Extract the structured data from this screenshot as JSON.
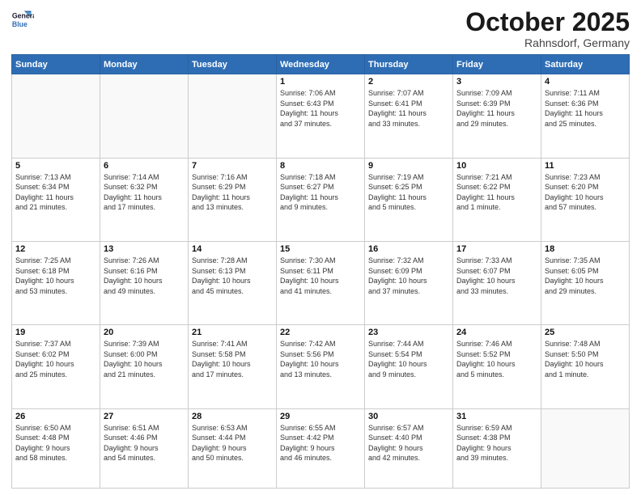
{
  "logo": {
    "line1": "General",
    "line2": "Blue"
  },
  "title": "October 2025",
  "location": "Rahnsdorf, Germany",
  "weekdays": [
    "Sunday",
    "Monday",
    "Tuesday",
    "Wednesday",
    "Thursday",
    "Friday",
    "Saturday"
  ],
  "weeks": [
    [
      {
        "day": "",
        "info": ""
      },
      {
        "day": "",
        "info": ""
      },
      {
        "day": "",
        "info": ""
      },
      {
        "day": "1",
        "info": "Sunrise: 7:06 AM\nSunset: 6:43 PM\nDaylight: 11 hours\nand 37 minutes."
      },
      {
        "day": "2",
        "info": "Sunrise: 7:07 AM\nSunset: 6:41 PM\nDaylight: 11 hours\nand 33 minutes."
      },
      {
        "day": "3",
        "info": "Sunrise: 7:09 AM\nSunset: 6:39 PM\nDaylight: 11 hours\nand 29 minutes."
      },
      {
        "day": "4",
        "info": "Sunrise: 7:11 AM\nSunset: 6:36 PM\nDaylight: 11 hours\nand 25 minutes."
      }
    ],
    [
      {
        "day": "5",
        "info": "Sunrise: 7:13 AM\nSunset: 6:34 PM\nDaylight: 11 hours\nand 21 minutes."
      },
      {
        "day": "6",
        "info": "Sunrise: 7:14 AM\nSunset: 6:32 PM\nDaylight: 11 hours\nand 17 minutes."
      },
      {
        "day": "7",
        "info": "Sunrise: 7:16 AM\nSunset: 6:29 PM\nDaylight: 11 hours\nand 13 minutes."
      },
      {
        "day": "8",
        "info": "Sunrise: 7:18 AM\nSunset: 6:27 PM\nDaylight: 11 hours\nand 9 minutes."
      },
      {
        "day": "9",
        "info": "Sunrise: 7:19 AM\nSunset: 6:25 PM\nDaylight: 11 hours\nand 5 minutes."
      },
      {
        "day": "10",
        "info": "Sunrise: 7:21 AM\nSunset: 6:22 PM\nDaylight: 11 hours\nand 1 minute."
      },
      {
        "day": "11",
        "info": "Sunrise: 7:23 AM\nSunset: 6:20 PM\nDaylight: 10 hours\nand 57 minutes."
      }
    ],
    [
      {
        "day": "12",
        "info": "Sunrise: 7:25 AM\nSunset: 6:18 PM\nDaylight: 10 hours\nand 53 minutes."
      },
      {
        "day": "13",
        "info": "Sunrise: 7:26 AM\nSunset: 6:16 PM\nDaylight: 10 hours\nand 49 minutes."
      },
      {
        "day": "14",
        "info": "Sunrise: 7:28 AM\nSunset: 6:13 PM\nDaylight: 10 hours\nand 45 minutes."
      },
      {
        "day": "15",
        "info": "Sunrise: 7:30 AM\nSunset: 6:11 PM\nDaylight: 10 hours\nand 41 minutes."
      },
      {
        "day": "16",
        "info": "Sunrise: 7:32 AM\nSunset: 6:09 PM\nDaylight: 10 hours\nand 37 minutes."
      },
      {
        "day": "17",
        "info": "Sunrise: 7:33 AM\nSunset: 6:07 PM\nDaylight: 10 hours\nand 33 minutes."
      },
      {
        "day": "18",
        "info": "Sunrise: 7:35 AM\nSunset: 6:05 PM\nDaylight: 10 hours\nand 29 minutes."
      }
    ],
    [
      {
        "day": "19",
        "info": "Sunrise: 7:37 AM\nSunset: 6:02 PM\nDaylight: 10 hours\nand 25 minutes."
      },
      {
        "day": "20",
        "info": "Sunrise: 7:39 AM\nSunset: 6:00 PM\nDaylight: 10 hours\nand 21 minutes."
      },
      {
        "day": "21",
        "info": "Sunrise: 7:41 AM\nSunset: 5:58 PM\nDaylight: 10 hours\nand 17 minutes."
      },
      {
        "day": "22",
        "info": "Sunrise: 7:42 AM\nSunset: 5:56 PM\nDaylight: 10 hours\nand 13 minutes."
      },
      {
        "day": "23",
        "info": "Sunrise: 7:44 AM\nSunset: 5:54 PM\nDaylight: 10 hours\nand 9 minutes."
      },
      {
        "day": "24",
        "info": "Sunrise: 7:46 AM\nSunset: 5:52 PM\nDaylight: 10 hours\nand 5 minutes."
      },
      {
        "day": "25",
        "info": "Sunrise: 7:48 AM\nSunset: 5:50 PM\nDaylight: 10 hours\nand 1 minute."
      }
    ],
    [
      {
        "day": "26",
        "info": "Sunrise: 6:50 AM\nSunset: 4:48 PM\nDaylight: 9 hours\nand 58 minutes."
      },
      {
        "day": "27",
        "info": "Sunrise: 6:51 AM\nSunset: 4:46 PM\nDaylight: 9 hours\nand 54 minutes."
      },
      {
        "day": "28",
        "info": "Sunrise: 6:53 AM\nSunset: 4:44 PM\nDaylight: 9 hours\nand 50 minutes."
      },
      {
        "day": "29",
        "info": "Sunrise: 6:55 AM\nSunset: 4:42 PM\nDaylight: 9 hours\nand 46 minutes."
      },
      {
        "day": "30",
        "info": "Sunrise: 6:57 AM\nSunset: 4:40 PM\nDaylight: 9 hours\nand 42 minutes."
      },
      {
        "day": "31",
        "info": "Sunrise: 6:59 AM\nSunset: 4:38 PM\nDaylight: 9 hours\nand 39 minutes."
      },
      {
        "day": "",
        "info": ""
      }
    ]
  ]
}
